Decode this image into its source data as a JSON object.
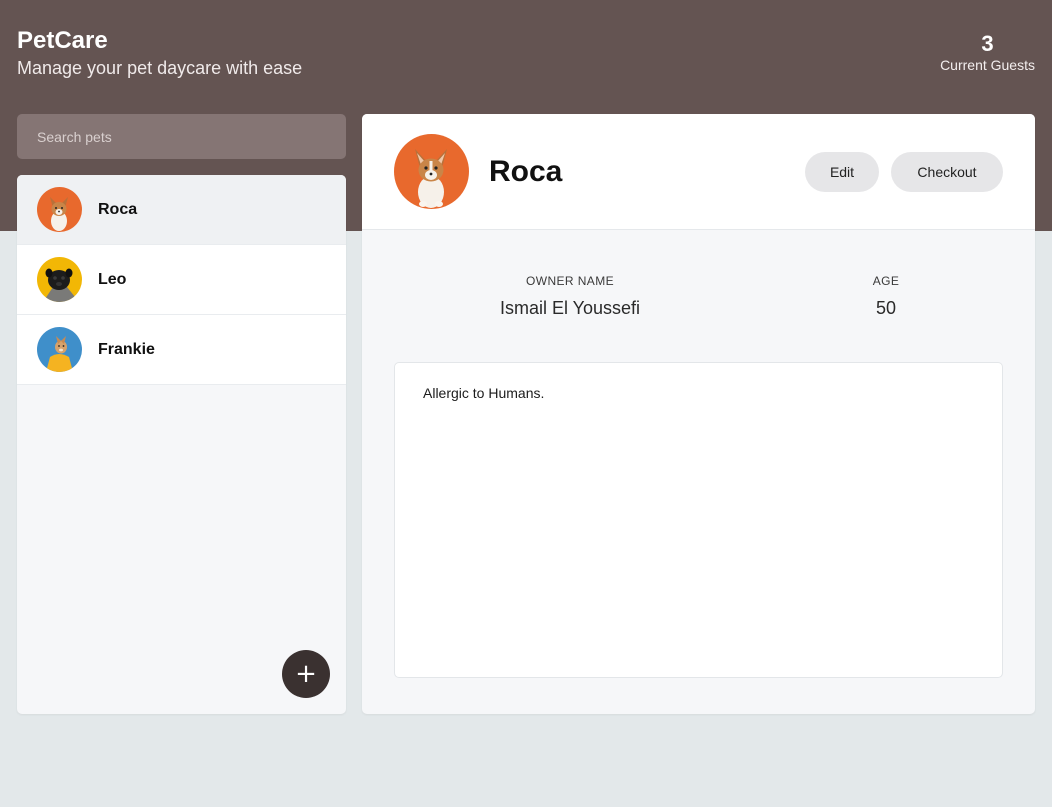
{
  "app": {
    "title": "PetCare",
    "subtitle": "Manage your pet daycare with ease"
  },
  "stats": {
    "guest_count": "3",
    "guest_label": "Current Guests"
  },
  "search": {
    "placeholder": "Search pets",
    "value": ""
  },
  "pets": [
    {
      "name": "Roca",
      "selected": true,
      "avatar_bg": "#e86a2e"
    },
    {
      "name": "Leo",
      "selected": false,
      "avatar_bg": "#f2b705"
    },
    {
      "name": "Frankie",
      "selected": false,
      "avatar_bg": "#3d8ec9"
    }
  ],
  "add_button": {
    "label": "+"
  },
  "selected_pet": {
    "name": "Roca",
    "owner_label": "OWNER NAME",
    "owner_name": "Ismail El Youssefi",
    "age_label": "AGE",
    "age": "50",
    "notes": "Allergic to Humans.",
    "edit_label": "Edit",
    "checkout_label": "Checkout"
  },
  "colors": {
    "header_bg": "#645452",
    "search_bg": "#857574",
    "page_bg": "#e3e8ea",
    "add_button_bg": "#3a3130"
  }
}
